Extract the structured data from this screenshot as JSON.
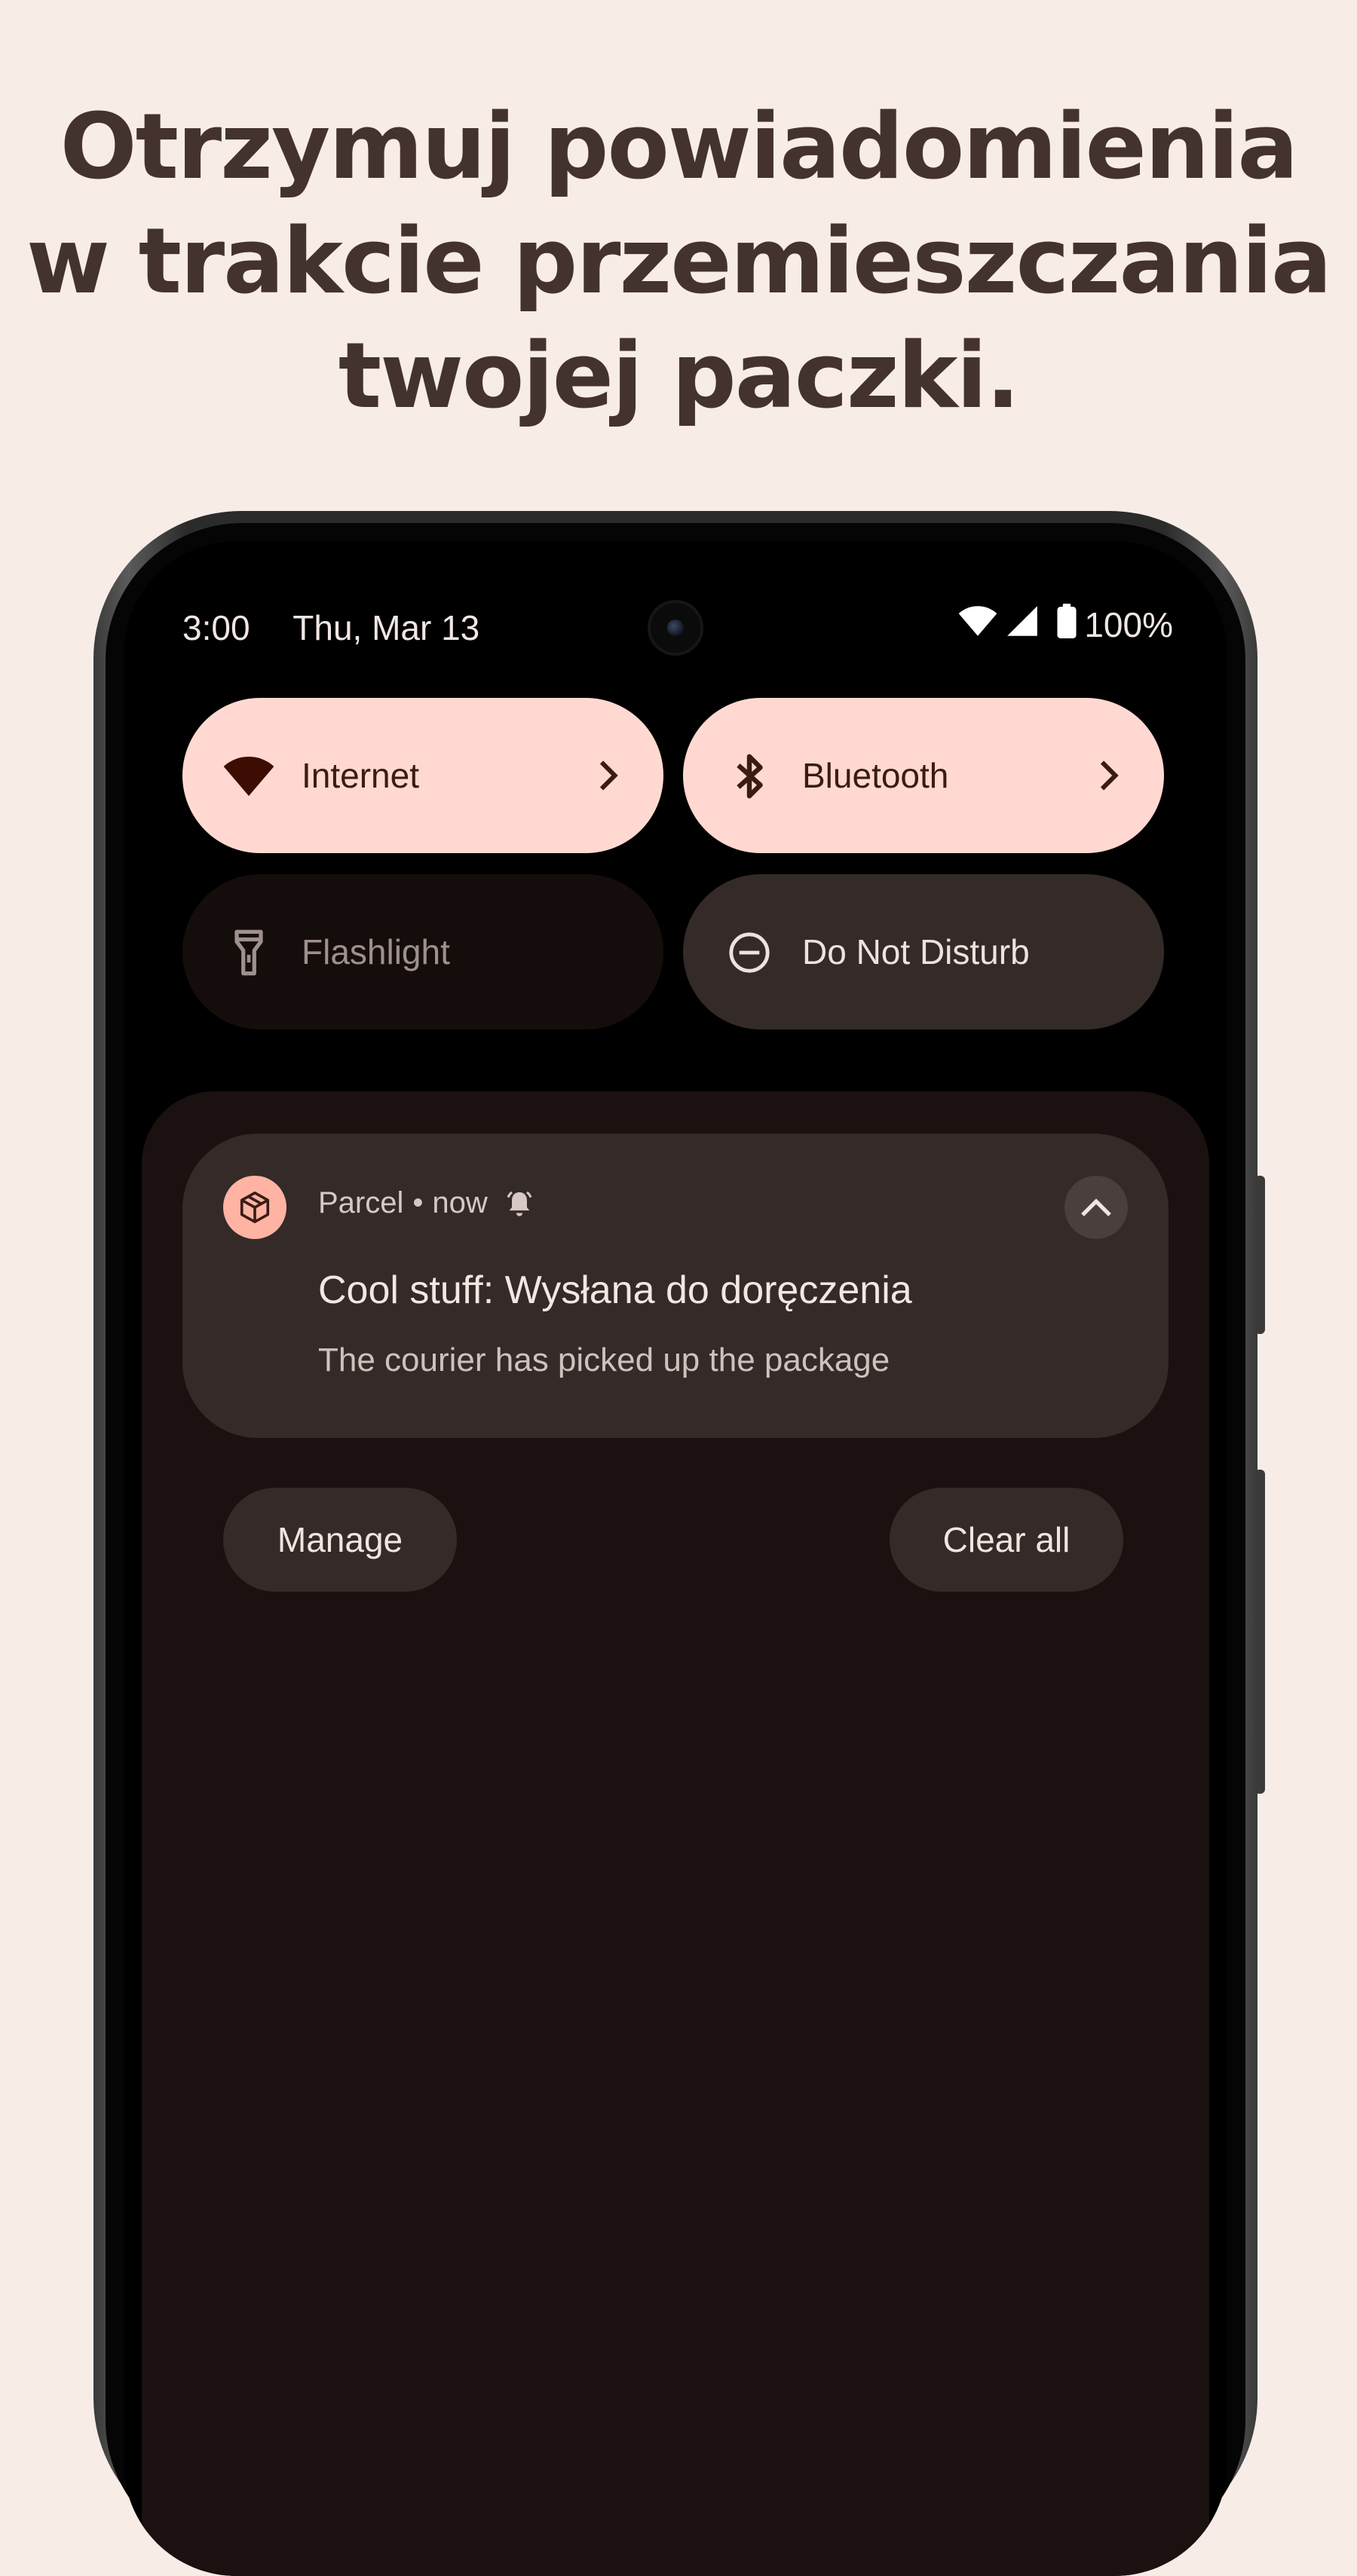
{
  "headline": {
    "line1": "Otrzymuj powiadomienia",
    "line2": "w trakcie przemieszczania",
    "line3": "twojej paczki."
  },
  "status_bar": {
    "time": "3:00",
    "date": "Thu, Mar 13",
    "battery": "100%",
    "icons": [
      "wifi-icon",
      "signal-icon",
      "battery-icon"
    ]
  },
  "quick_settings": {
    "internet": {
      "label": "Internet",
      "icon": "wifi-icon",
      "state": "on"
    },
    "bluetooth": {
      "label": "Bluetooth",
      "icon": "bluetooth-icon",
      "state": "on"
    },
    "flashlight": {
      "label": "Flashlight",
      "icon": "flashlight-icon",
      "state": "off"
    },
    "dnd": {
      "label": "Do Not Disturb",
      "icon": "do-not-disturb-icon",
      "state": "off"
    }
  },
  "notification": {
    "app_name": "Parcel",
    "separator": "•",
    "time": "now",
    "title": "Cool stuff: Wysłana do doręczenia",
    "text": "The courier has picked up the package",
    "icons": [
      "package-icon",
      "alert-bell-icon",
      "chevron-up-icon"
    ]
  },
  "actions": {
    "manage": "Manage",
    "clear_all": "Clear all"
  },
  "colors": {
    "page_background": "#f8ece7",
    "headline": "#44332d",
    "tile_active": "#ffd9d1",
    "tile_inactive": "#342a28",
    "app_icon_accent": "#ffb4a3",
    "shade": "#1a1110"
  }
}
